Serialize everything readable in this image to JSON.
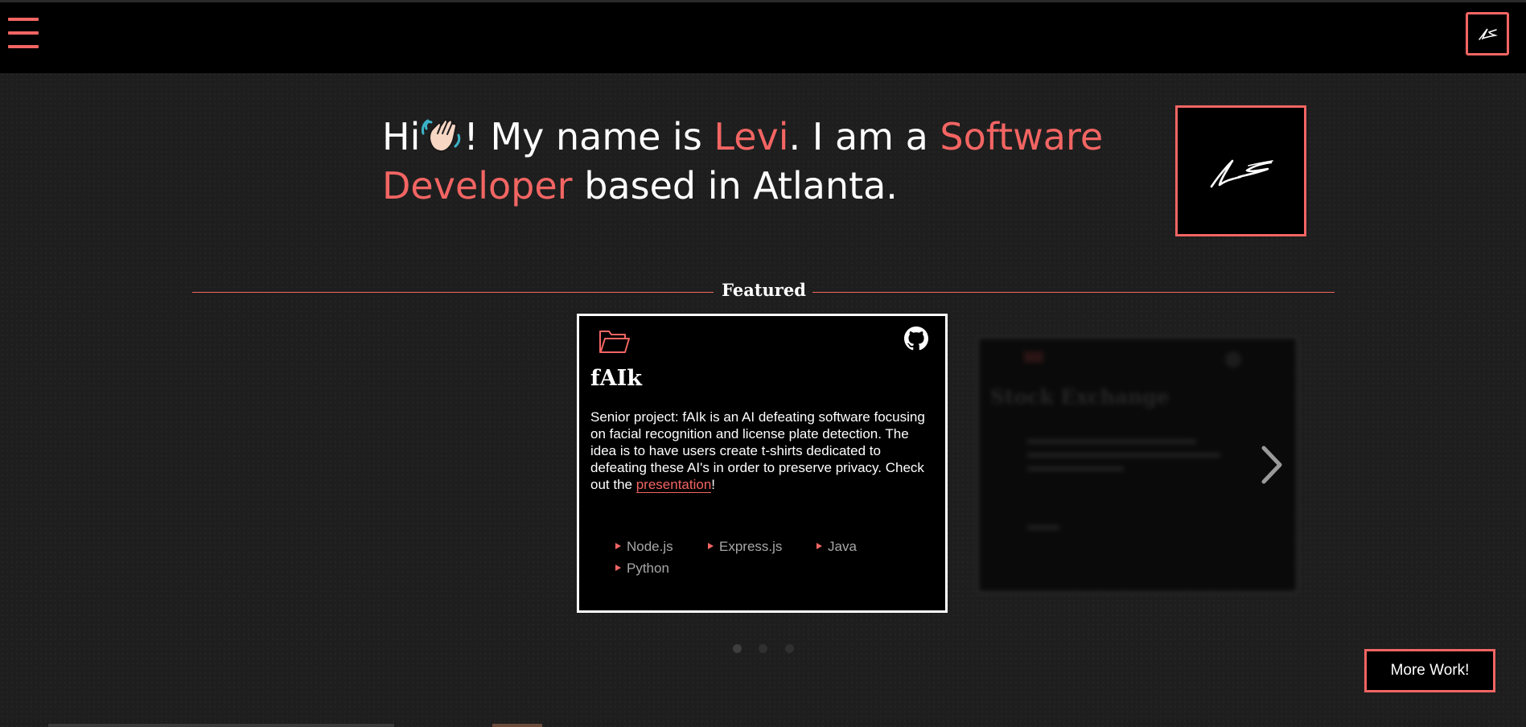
{
  "nav": {
    "menu_icon": "hamburger-menu-icon",
    "logo_icon": "signature-logo-icon"
  },
  "hero": {
    "greeting": "Hi",
    "wave_icon": "waving-hand-icon",
    "after_wave": "! My name is ",
    "name": "Levi",
    "middle": ". I am a ",
    "role": "Software Developer",
    "end": " based in Atlanta."
  },
  "colors": {
    "accent": "#f26563",
    "background": "#1e1e1e",
    "navbar": "#000000"
  },
  "featured": {
    "heading": "Featured",
    "card": {
      "folder_icon": "folder-icon",
      "github_icon": "github-icon",
      "title": "fAIk",
      "desc_before": "Senior project: fAIk is an AI defeating software focusing on facial recognition and license plate detection. The idea is to have users create t-shirts dedicated to defeating these AI's in order to preserve privacy. Check out the ",
      "link_text": "presentation",
      "desc_after": "!",
      "tech": [
        "Node.js",
        "Express.js",
        "Java",
        "Python"
      ]
    },
    "next_card": {
      "title": "Stock Exchange"
    },
    "next_arrow_icon": "chevron-right-icon",
    "carousel_pages": 3,
    "carousel_active": 1
  },
  "more_button": "More Work!"
}
